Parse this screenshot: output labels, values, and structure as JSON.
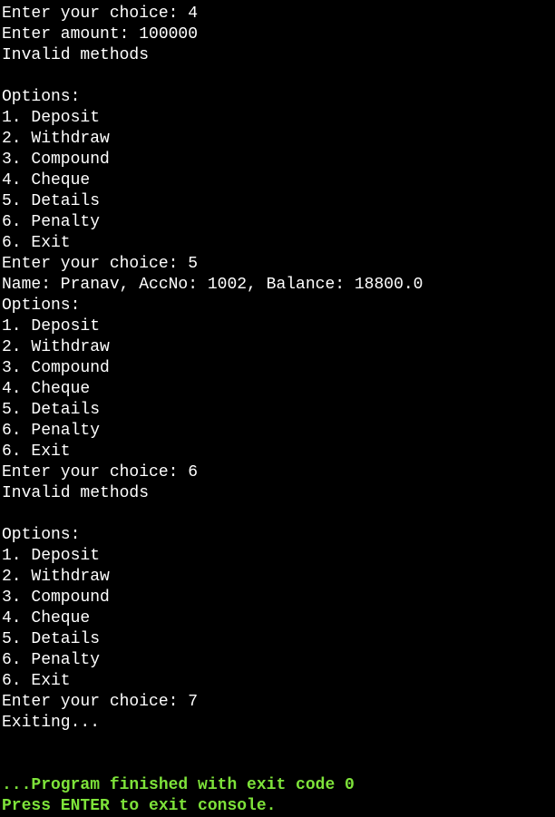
{
  "colors": {
    "background": "#000000",
    "text": "#ffffff",
    "status": "#7ee33a"
  },
  "console": {
    "lines": [
      "Enter your choice: 4",
      "Enter amount: 100000",
      "Invalid methods",
      "",
      "Options:",
      "1. Deposit",
      "2. Withdraw",
      "3. Compound",
      "4. Cheque",
      "5. Details",
      "6. Penalty",
      "6. Exit",
      "Enter your choice: 5",
      "Name: Pranav, AccNo: 1002, Balance: 18800.0",
      "Options:",
      "1. Deposit",
      "2. Withdraw",
      "3. Compound",
      "4. Cheque",
      "5. Details",
      "6. Penalty",
      "6. Exit",
      "Enter your choice: 6",
      "Invalid methods",
      "",
      "Options:",
      "1. Deposit",
      "2. Withdraw",
      "3. Compound",
      "4. Cheque",
      "5. Details",
      "6. Penalty",
      "6. Exit",
      "Enter your choice: 7",
      "Exiting...",
      "",
      ""
    ],
    "status_lines": [
      "...Program finished with exit code 0",
      "Press ENTER to exit console."
    ]
  }
}
